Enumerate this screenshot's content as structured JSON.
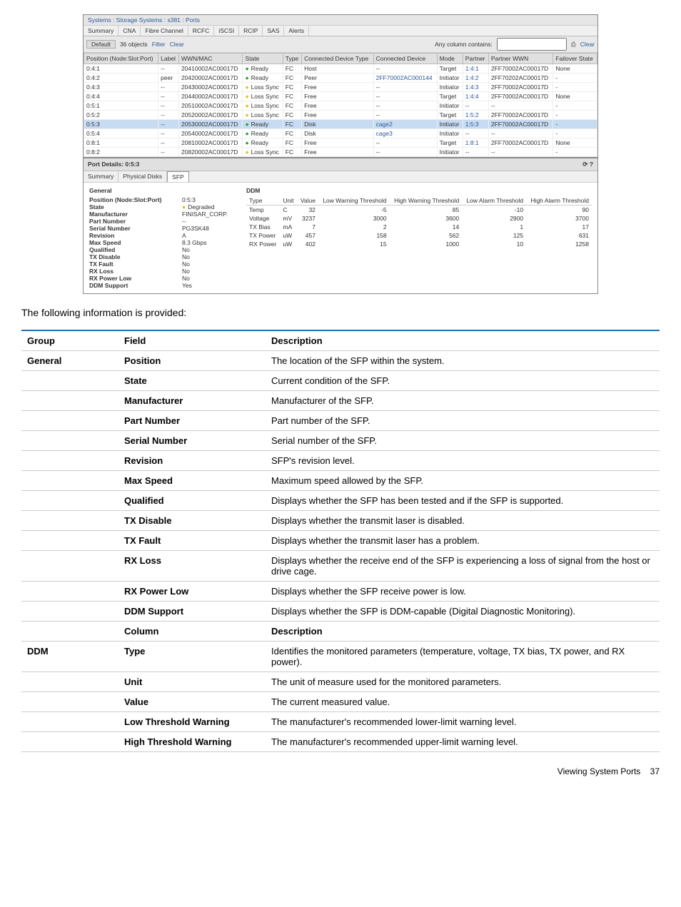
{
  "breadcrumb": "Systems : Storage Systems : s381 : Ports",
  "topTabs": [
    "Summary",
    "CNA",
    "Fibre Channel",
    "RCFC",
    "iSCSI",
    "RCIP",
    "SAS",
    "Alerts"
  ],
  "filterbar": {
    "default_label": "Default",
    "count": "36 objects",
    "filter_label": "Filter",
    "clear_label": "Clear",
    "anycol": "Any column contains:",
    "clear_btn": "Clear"
  },
  "portCols": [
    "Position (Node:Slot:Port)",
    "Label",
    "WWN/MAC",
    "State",
    "Type",
    "Connected Device Type",
    "Connected Device",
    "Mode",
    "Partner",
    "Partner WWN",
    "Failover State"
  ],
  "portRows": [
    {
      "pos": "0:4:1",
      "label": "--",
      "wwn": "20410002AC00017D",
      "state": "Ready",
      "st": "g",
      "type": "FC",
      "cdt": "Host",
      "cd": "--",
      "mode": "Target",
      "partner": "1:4:1",
      "pwwn": "2FF70002AC00017D",
      "fail": "None"
    },
    {
      "pos": "0:4:2",
      "label": "peer",
      "wwn": "20420002AC00017D",
      "state": "Ready",
      "st": "g",
      "type": "FC",
      "cdt": "Peer",
      "cd": "2FF70002AC000144",
      "mode": "Initiator",
      "partner": "1:4:2",
      "pwwn": "2FF70202AC00017D",
      "fail": "-"
    },
    {
      "pos": "0:4:3",
      "label": "--",
      "wwn": "20430002AC00017D",
      "state": "Loss Sync",
      "st": "y",
      "type": "FC",
      "cdt": "Free",
      "cd": "--",
      "mode": "Initiator",
      "partner": "1:4:3",
      "pwwn": "2FF70002AC00017D",
      "fail": "-"
    },
    {
      "pos": "0:4:4",
      "label": "--",
      "wwn": "20440002AC00017D",
      "state": "Loss Sync",
      "st": "y",
      "type": "FC",
      "cdt": "Free",
      "cd": "--",
      "mode": "Target",
      "partner": "1:4:4",
      "pwwn": "2FF70002AC00017D",
      "fail": "None"
    },
    {
      "pos": "0:5:1",
      "label": "--",
      "wwn": "20510002AC00017D",
      "state": "Loss Sync",
      "st": "y",
      "type": "FC",
      "cdt": "Free",
      "cd": "--",
      "mode": "Initiator",
      "partner": "--",
      "pwwn": "--",
      "fail": "-"
    },
    {
      "pos": "0:5:2",
      "label": "--",
      "wwn": "20520002AC00017D",
      "state": "Loss Sync",
      "st": "y",
      "type": "FC",
      "cdt": "Free",
      "cd": "--",
      "mode": "Target",
      "partner": "1:5:2",
      "pwwn": "2FF70002AC00017D",
      "fail": "-"
    },
    {
      "pos": "0:5:3",
      "label": "--",
      "wwn": "20530002AC00017D",
      "state": "Ready",
      "st": "g",
      "type": "FC",
      "cdt": "Disk",
      "cd": "cage2",
      "mode": "Initiator",
      "partner": "1:5:3",
      "pwwn": "2FF70002AC00017D",
      "fail": "-",
      "sel": true
    },
    {
      "pos": "0:5:4",
      "label": "--",
      "wwn": "20540002AC00017D",
      "state": "Ready",
      "st": "g",
      "type": "FC",
      "cdt": "Disk",
      "cd": "cage3",
      "mode": "Initiator",
      "partner": "--",
      "pwwn": "--",
      "fail": "-"
    },
    {
      "pos": "0:8:1",
      "label": "--",
      "wwn": "20810002AC00017D",
      "state": "Ready",
      "st": "g",
      "type": "FC",
      "cdt": "Free",
      "cd": "--",
      "mode": "Target",
      "partner": "1:8:1",
      "pwwn": "2FF70002AC00017D",
      "fail": "None"
    },
    {
      "pos": "0:8:2",
      "label": "--",
      "wwn": "20820002AC00017D",
      "state": "Loss Sync",
      "st": "y",
      "type": "FC",
      "cdt": "Free",
      "cd": "--",
      "mode": "Initiator",
      "partner": "--",
      "pwwn": "--",
      "fail": "-"
    }
  ],
  "detail": {
    "title": "Port Details: 0:5:3",
    "subTabs": [
      "Summary",
      "Physical Disks",
      "SFP"
    ],
    "general_hdg": "General",
    "general": [
      {
        "k": "Position (Node:Slot:Port)",
        "v": "0:5:3"
      },
      {
        "k": "State",
        "v": "Degraded",
        "deg": true
      },
      {
        "k": "Manufacturer",
        "v": "FINISAR_CORP."
      },
      {
        "k": "Part Number",
        "v": "--"
      },
      {
        "k": "Serial Number",
        "v": "PG3SK48"
      },
      {
        "k": "Revision",
        "v": "A"
      },
      {
        "k": "Max Speed",
        "v": "8.3 Gbps"
      },
      {
        "k": "Qualified",
        "v": "No"
      },
      {
        "k": "TX Disable",
        "v": "No"
      },
      {
        "k": "TX Fault",
        "v": "No"
      },
      {
        "k": "RX Loss",
        "v": "No"
      },
      {
        "k": "RX Power Low",
        "v": "No"
      },
      {
        "k": "DDM Support",
        "v": "Yes"
      }
    ],
    "ddm_hdg": "DDM",
    "ddmCols": [
      "Type",
      "Unit",
      "Value",
      "Low Warning Threshold",
      "High Warning Threshold",
      "Low Alarm Threshold",
      "High Alarm Threshold"
    ],
    "ddmRows": [
      {
        "type": "Temp",
        "unit": "C",
        "value": "32",
        "lw": "-5",
        "hw": "85",
        "la": "-10",
        "ha": "90"
      },
      {
        "type": "Voltage",
        "unit": "mV",
        "value": "3237",
        "lw": "3000",
        "hw": "3600",
        "la": "2900",
        "ha": "3700"
      },
      {
        "type": "TX Bias",
        "unit": "mA",
        "value": "7",
        "lw": "2",
        "hw": "14",
        "la": "1",
        "ha": "17"
      },
      {
        "type": "TX Power",
        "unit": "uW",
        "value": "457",
        "lw": "158",
        "hw": "562",
        "la": "125",
        "ha": "631"
      },
      {
        "type": "RX Power",
        "unit": "uW",
        "value": "402",
        "lw": "15",
        "hw": "1000",
        "la": "10",
        "ha": "1258"
      }
    ]
  },
  "prose": "The following information is provided:",
  "infoTable": {
    "head": [
      "Group",
      "Field",
      "Description"
    ],
    "generalRows": [
      {
        "group": "General",
        "field": "Position",
        "desc": "The location of the SFP within the system."
      },
      {
        "field": "State",
        "desc": "Current condition of the SFP."
      },
      {
        "field": "Manufacturer",
        "desc": "Manufacturer of the SFP."
      },
      {
        "field": "Part Number",
        "desc": "Part number of the SFP."
      },
      {
        "field": "Serial Number",
        "desc": "Serial number of the SFP."
      },
      {
        "field": "Revision",
        "desc": "SFP's revision level."
      },
      {
        "field": "Max Speed",
        "desc": "Maximum speed allowed by the SFP."
      },
      {
        "field": "Qualified",
        "desc": "Displays whether the SFP has been tested and if the SFP is supported."
      },
      {
        "field": "TX Disable",
        "desc": "Displays whether the transmit laser is disabled."
      },
      {
        "field": "TX Fault",
        "desc": "Displays whether the transmit laser has a problem."
      },
      {
        "field": "RX Loss",
        "desc": "Displays whether the receive end of the SFP is experiencing a loss of signal from the host or drive cage."
      },
      {
        "field": "RX Power Low",
        "desc": "Displays whether the SFP receive power is low."
      },
      {
        "field": "DDM Support",
        "desc": "Displays whether the SFP is DDM-capable (Digital Diagnostic Monitoring)."
      }
    ],
    "subhead": {
      "field": "Column",
      "desc": "Description"
    },
    "ddmRows": [
      {
        "group": "DDM",
        "field": "Type",
        "desc": "Identifies the monitored parameters (temperature, voltage, TX bias, TX power, and RX power)."
      },
      {
        "field": "Unit",
        "desc": "The unit of measure used for the monitored parameters."
      },
      {
        "field": "Value",
        "desc": "The current measured value."
      },
      {
        "field": "Low Threshold Warning",
        "desc": "The manufacturer's recommended lower-limit warning level."
      },
      {
        "field": "High Threshold Warning",
        "desc": "The manufacturer's recommended upper-limit warning level."
      }
    ]
  },
  "footer": {
    "text": "Viewing System Ports",
    "page": "37"
  }
}
